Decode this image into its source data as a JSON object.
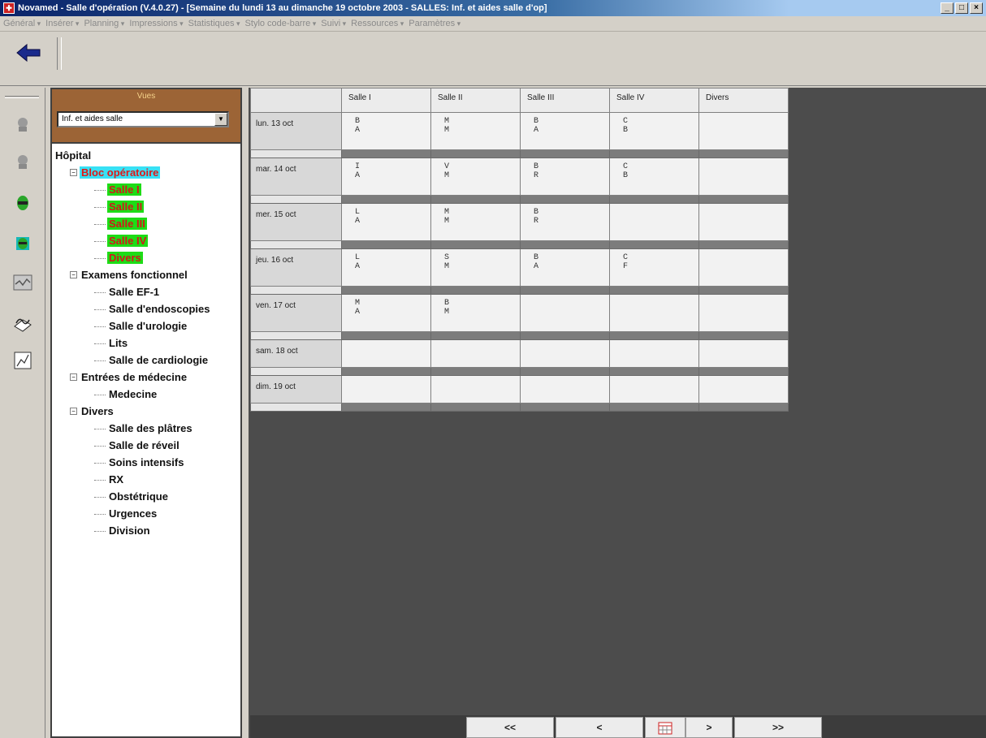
{
  "window": {
    "title": "Novamed - Salle d'opération (V.4.0.27) - [Semaine du lundi 13 au dimanche 19 octobre 2003 - SALLES: Inf. et aides salle d'op]",
    "min_label": "_",
    "max_label": "□",
    "close_label": "×"
  },
  "menu": [
    "Général",
    "Insérer",
    "Planning",
    "Impressions",
    "Statistiques",
    "Stylo code-barre",
    "Suivi",
    "Ressources",
    "Paramètres"
  ],
  "vues": {
    "title": "Vues",
    "selected": "Inf. et aides salle"
  },
  "tree": {
    "root": "Hôpital",
    "groups": [
      {
        "label": "Bloc opératoire",
        "items": [
          "Salle I",
          "Salle II",
          "Salle III",
          "Salle IV",
          "Divers"
        ]
      },
      {
        "label": "Examens fonctionnel",
        "items": [
          "Salle EF-1",
          "Salle d'endoscopies",
          "Salle d'urologie",
          "Lits",
          "Salle de cardiologie"
        ]
      },
      {
        "label": "Entrées de médecine",
        "items": [
          "Medecine"
        ]
      },
      {
        "label": "Divers",
        "items": [
          "Salle des plâtres",
          "Salle de réveil",
          "Soins intensifs",
          "RX",
          "Obstétrique",
          "Urgences",
          "Division"
        ]
      }
    ]
  },
  "schedule": {
    "columns": [
      "Salle I",
      "Salle II",
      "Salle III",
      "Salle IV",
      "Divers"
    ],
    "days": [
      {
        "label": "lun. 13 oct",
        "cells": [
          [
            "B",
            "A"
          ],
          [
            "M",
            "M"
          ],
          [
            "B",
            "A"
          ],
          [
            "C",
            "B"
          ],
          []
        ]
      },
      {
        "label": "mar. 14 oct",
        "cells": [
          [
            "I",
            "A"
          ],
          [
            "V",
            "M"
          ],
          [
            "B",
            "R"
          ],
          [
            "C",
            "B"
          ],
          []
        ]
      },
      {
        "label": "mer. 15 oct",
        "cells": [
          [
            "L",
            "A"
          ],
          [
            "M",
            "M"
          ],
          [
            "B",
            "R"
          ],
          [],
          []
        ]
      },
      {
        "label": "jeu. 16 oct",
        "cells": [
          [
            "L",
            "A"
          ],
          [
            "S",
            "M"
          ],
          [
            "B",
            "A"
          ],
          [
            "C",
            "F"
          ],
          []
        ]
      },
      {
        "label": "ven. 17 oct",
        "cells": [
          [
            "M",
            "A"
          ],
          [
            "B",
            "M"
          ],
          [],
          [],
          []
        ]
      },
      {
        "label": "sam. 18 oct",
        "cells": [
          [],
          [],
          [],
          [],
          []
        ]
      },
      {
        "label": "dim. 19 oct",
        "cells": [
          [],
          [],
          [],
          [],
          []
        ]
      }
    ]
  },
  "nav": {
    "first": "<<",
    "prev": "<",
    "next": ">",
    "last": ">>"
  }
}
